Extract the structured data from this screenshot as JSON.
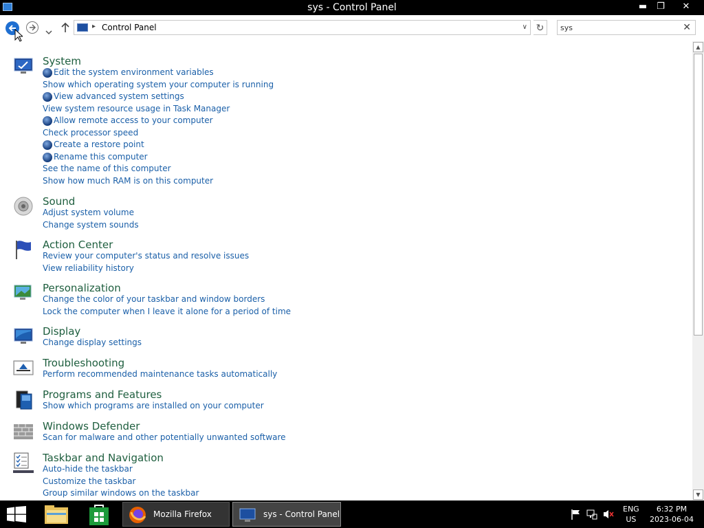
{
  "window": {
    "title": "sys - Control Panel",
    "buttons": {
      "minimize": "▬",
      "restore": "❐",
      "close": "✕"
    }
  },
  "nav": {
    "breadcrumb": "Control Panel",
    "breadcrumb_sep": "▸",
    "dropdown": "∨",
    "refresh": "↻",
    "search_value": "sys",
    "clear": "✕"
  },
  "groups": [
    {
      "title": "System",
      "icon": "system-monitor-icon",
      "links": [
        {
          "text": "Edit the system environment variables",
          "shield": true
        },
        {
          "text": "Show which operating system your computer is running",
          "shield": false
        },
        {
          "text": "View advanced system settings",
          "shield": true
        },
        {
          "text": "View system resource usage in Task Manager",
          "shield": false
        },
        {
          "text": "Allow remote access to your computer",
          "shield": true
        },
        {
          "text": "Check processor speed",
          "shield": false
        },
        {
          "text": "Create a restore point",
          "shield": true
        },
        {
          "text": "Rename this computer",
          "shield": true
        },
        {
          "text": "See the name of this computer",
          "shield": false
        },
        {
          "text": "Show how much RAM is on this computer",
          "shield": false
        }
      ]
    },
    {
      "title": "Sound",
      "icon": "speaker-icon",
      "links": [
        {
          "text": "Adjust system volume",
          "shield": false
        },
        {
          "text": "Change system sounds",
          "shield": false
        }
      ]
    },
    {
      "title": "Action Center",
      "icon": "flag-icon",
      "links": [
        {
          "text": "Review your computer's status and resolve issues",
          "shield": false
        },
        {
          "text": "View reliability history",
          "shield": false
        }
      ]
    },
    {
      "title": "Personalization",
      "icon": "personalization-icon",
      "links": [
        {
          "text": "Change the color of your taskbar and window borders",
          "shield": false
        },
        {
          "text": "Lock the computer when I leave it alone for a period of time",
          "shield": false
        }
      ]
    },
    {
      "title": "Display",
      "icon": "display-icon",
      "links": [
        {
          "text": "Change display settings",
          "shield": false
        }
      ]
    },
    {
      "title": "Troubleshooting",
      "icon": "troubleshooting-icon",
      "links": [
        {
          "text": "Perform recommended maintenance tasks automatically",
          "shield": false
        }
      ]
    },
    {
      "title": "Programs and Features",
      "icon": "programs-icon",
      "links": [
        {
          "text": "Show which programs are installed on your computer",
          "shield": false
        }
      ]
    },
    {
      "title": "Windows Defender",
      "icon": "defender-wall-icon",
      "links": [
        {
          "text": "Scan for malware and other potentially unwanted software",
          "shield": false
        }
      ]
    },
    {
      "title": "Taskbar and Navigation",
      "icon": "taskbar-checklist-icon",
      "links": [
        {
          "text": "Auto-hide the taskbar",
          "shield": false
        },
        {
          "text": "Customize the taskbar",
          "shield": false
        },
        {
          "text": "Group similar windows on the taskbar",
          "shield": false
        }
      ]
    }
  ],
  "taskbar": {
    "tasks": [
      {
        "label": "Mozilla Firefox",
        "icon": "firefox-icon"
      },
      {
        "label": "sys - Control Panel",
        "icon": "control-panel-icon"
      }
    ],
    "language": {
      "line1": "ENG",
      "line2": "US"
    },
    "clock": {
      "time": "6:32 PM",
      "date": "2023-06-04"
    }
  },
  "colors": {
    "group_title": "#1e5e3e",
    "link": "#1a5fa8",
    "taskbar": "#000000"
  }
}
